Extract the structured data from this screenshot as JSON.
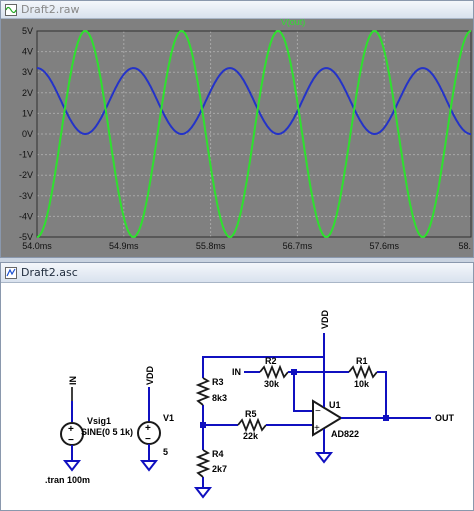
{
  "plot_window": {
    "title": "Draft2.raw",
    "trace_label": "V(out)",
    "colors": {
      "bg": "#808080",
      "grid": "#a8a8a8",
      "trace_in": "#2433c8",
      "trace_out": "#2ee12e",
      "axis_text": "#101010"
    }
  },
  "chart_data": {
    "type": "line",
    "title": "",
    "xlabel": "",
    "ylabel": "",
    "x_tick_labels": [
      "54.0ms",
      "54.9ms",
      "55.8ms",
      "56.7ms",
      "57.6ms",
      "58."
    ],
    "y_tick_labels": [
      "5V",
      "4V",
      "3V",
      "2V",
      "1V",
      "0V",
      "-1V",
      "-2V",
      "-3V",
      "-4V",
      "-5V"
    ],
    "xlim": [
      54.0,
      58.5
    ],
    "ylim": [
      -5,
      5
    ],
    "grid": true,
    "series": [
      {
        "name": "V(out)",
        "color": "#2ee12e",
        "amplitude": 5,
        "offset": 0,
        "frequency_khz": 1,
        "phase_at_start_deg": -90
      },
      {
        "name": "",
        "color": "#2433c8",
        "amplitude": 1.6,
        "offset": 1.6,
        "frequency_khz": 1,
        "phase_at_start_deg": 90
      }
    ]
  },
  "schematic_window": {
    "title": "Draft2.asc",
    "labels": {
      "in_port": "IN",
      "vdd_left": "VDD",
      "vdd_top": "VDD",
      "in_net": "IN",
      "out_net": "OUT",
      "vsig_name": "Vsig1",
      "vsig_value": "SINE(0 5 1k)",
      "v1_name": "V1",
      "v1_value": "5",
      "directive": ".tran 100m",
      "r3_name": "R3",
      "r3_value": "8k3",
      "r4_name": "R4",
      "r4_value": "2k7",
      "r2_name": "R2",
      "r2_value": "30k",
      "r1_name": "R1",
      "r1_value": "10k",
      "r5_name": "R5",
      "r5_value": "22k",
      "u1_name": "U1",
      "u1_value": "AD822",
      "op_plus": "+",
      "op_minus": "−"
    },
    "colors": {
      "wire": "#1010c0",
      "component": "#1a1a1a",
      "port": "#000000"
    }
  }
}
